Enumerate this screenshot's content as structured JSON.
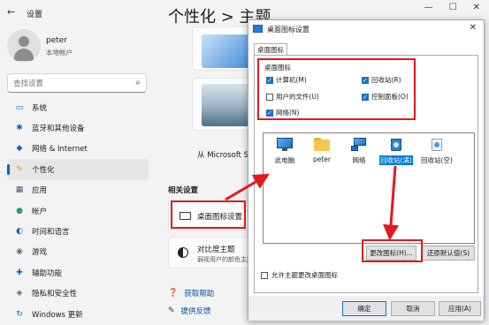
{
  "window": {
    "title": "设置",
    "controls": [
      "—",
      "☐",
      "✕"
    ]
  },
  "profile": {
    "name": "peter",
    "account_type": "本地帐户"
  },
  "search": {
    "placeholder": "查找设置"
  },
  "nav": [
    {
      "label": "系统",
      "icon": "monitor-icon",
      "glyph": "▭",
      "color": "#0067c0"
    },
    {
      "label": "蓝牙和其他设备",
      "icon": "bluetooth-icon",
      "glyph": "✱",
      "color": "#0067c0"
    },
    {
      "label": "网络 & Internet",
      "icon": "wifi-icon",
      "glyph": "◆",
      "color": "#0067c0"
    },
    {
      "label": "个性化",
      "icon": "pen-icon",
      "glyph": "✎",
      "color": "#e88a2e",
      "active": true
    },
    {
      "label": "应用",
      "icon": "apps-icon",
      "glyph": "▦",
      "color": "#455a73"
    },
    {
      "label": "帐户",
      "icon": "person-icon",
      "glyph": "●",
      "color": "#1fa06e"
    },
    {
      "label": "时间和语言",
      "icon": "globe-clock-icon",
      "glyph": "◐",
      "color": "#0067c0"
    },
    {
      "label": "游戏",
      "icon": "gamepad-icon",
      "glyph": "◉",
      "color": "#6b6b6b"
    },
    {
      "label": "辅助功能",
      "icon": "accessibility-icon",
      "glyph": "✚",
      "color": "#0067c0"
    },
    {
      "label": "隐私和安全性",
      "icon": "shield-icon",
      "glyph": "◈",
      "color": "#5c6470"
    },
    {
      "label": "Windows 更新",
      "icon": "update-icon",
      "glyph": "↻",
      "color": "#0067c0"
    }
  ],
  "content": {
    "title": "个性化 > 主题",
    "store_link": "从 Microsoft Sto",
    "related_section": "相关设置",
    "desktop_icon_settings": "桌面图标设置",
    "contrast_title": "对比度主题",
    "contrast_sub": "弱视用户的颜色主题",
    "help": "获取帮助",
    "feedback": "提供反馈"
  },
  "dialog": {
    "title": "桌面图标设置",
    "tab": "桌面图标",
    "group": "桌面图标",
    "checkboxes": [
      {
        "label": "计算机(M)",
        "checked": true
      },
      {
        "label": "回收站(R)",
        "checked": true
      },
      {
        "label": "用户的文件(U)",
        "checked": false
      },
      {
        "label": "控制面板(O)",
        "checked": true
      },
      {
        "label": "网络(N)",
        "checked": true
      }
    ],
    "icons": [
      {
        "label": "此电脑",
        "icon": "computer-icon"
      },
      {
        "label": "peter",
        "icon": "folder-icon"
      },
      {
        "label": "网络",
        "icon": "network-icon"
      },
      {
        "label": "回收站(满)",
        "icon": "recycle-bin-full-icon",
        "selected": true
      },
      {
        "label": "回收站(空)",
        "icon": "recycle-bin-empty-icon"
      }
    ],
    "change_icon": "更改图标(H)...",
    "restore_default": "还原默认值(S)",
    "allow_theme": "允许主题更改桌面图标",
    "ok": "确定",
    "cancel": "取消",
    "apply": "应用(A)",
    "close": "✕"
  },
  "colors": {
    "highlight": "#e3191e",
    "accent": "#0067c0"
  }
}
